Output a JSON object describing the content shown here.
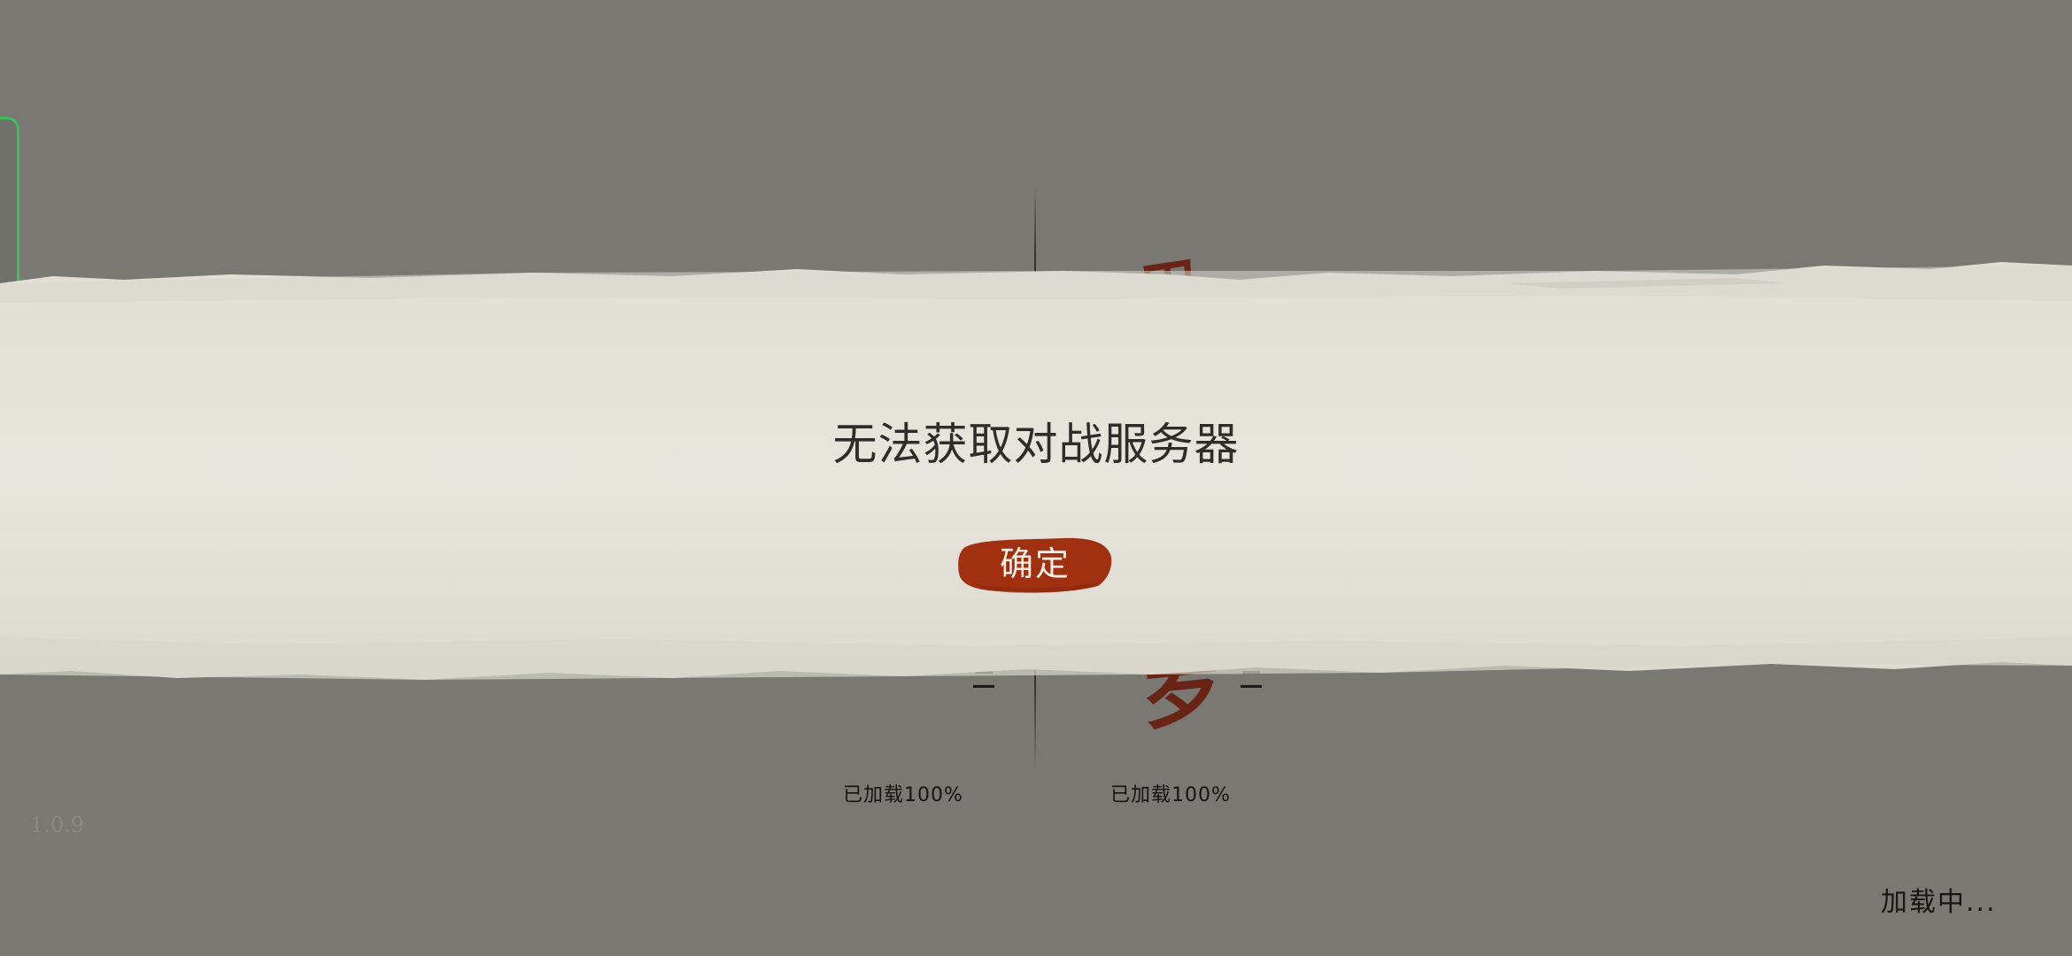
{
  "background": {
    "version_text": "1.0.9",
    "loading_status": "加载中...",
    "players": [
      {
        "load_progress_text": "已加载100%",
        "rank_mark": "二"
      },
      {
        "load_progress_text": "已加载100%",
        "rank_mark": "二",
        "name_glyph": "罗"
      }
    ]
  },
  "dialog": {
    "message": "无法获取对战服务器",
    "confirm_label": "确定"
  },
  "colors": {
    "backdrop": "#797873",
    "paper_band": "#e6e4da",
    "confirm_button": "#a0300f",
    "side_tab_outline": "#3fbf5a"
  }
}
